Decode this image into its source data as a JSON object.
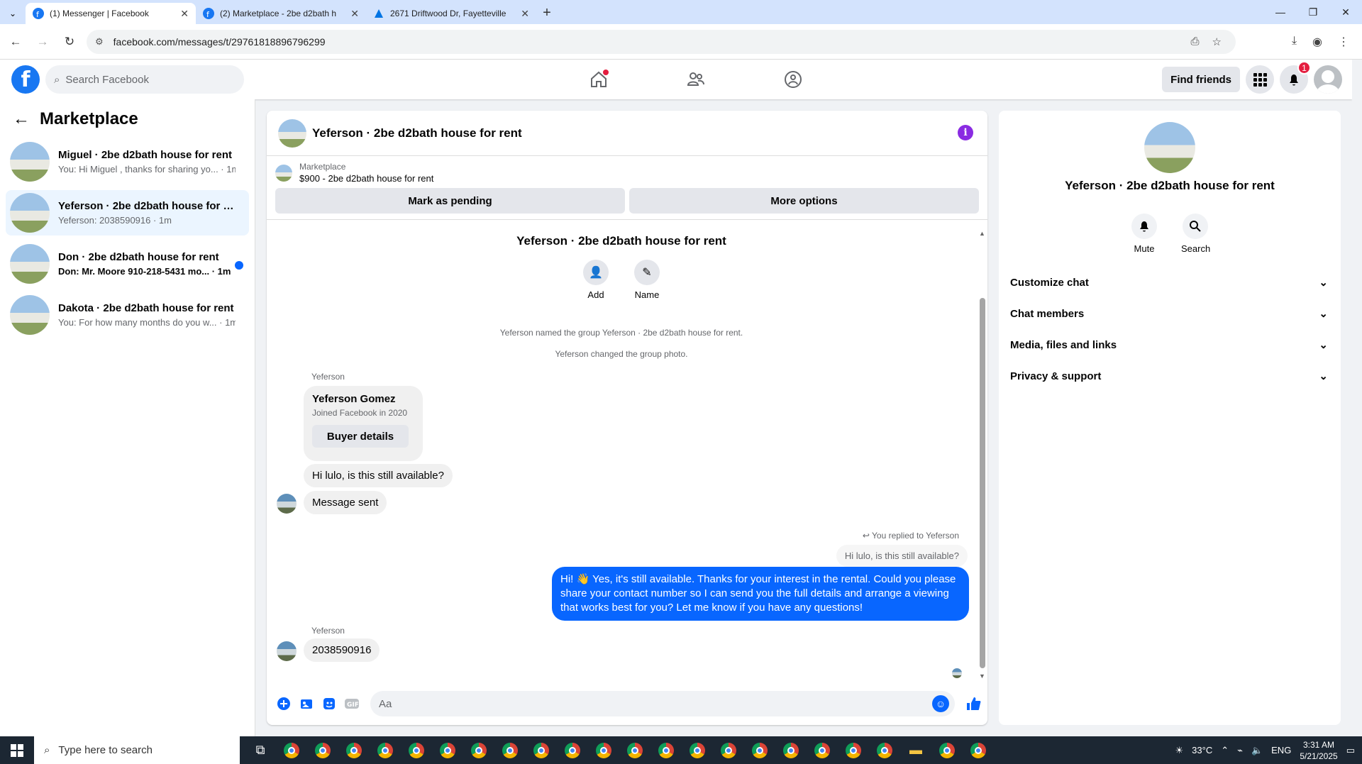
{
  "browser": {
    "tabs": [
      {
        "title": "(1) Messenger | Facebook",
        "active": true
      },
      {
        "title": "(2) Marketplace - 2be d2bath h",
        "active": false
      },
      {
        "title": "2671 Driftwood Dr, Fayetteville",
        "active": false
      }
    ],
    "url": "facebook.com/messages/t/29761818896796299"
  },
  "facebook": {
    "search_placeholder": "Search Facebook",
    "find_friends": "Find friends",
    "notif_count": "1"
  },
  "sidebar": {
    "title": "Marketplace",
    "conversations": [
      {
        "name": "Miguel · 2be d2bath house for rent",
        "preview": "You: Hi Miguel , thanks for sharing yo... · 1m",
        "selected": false,
        "unread": false
      },
      {
        "name": "Yeferson · 2be d2bath house for re...",
        "preview": "Yeferson: 2038590916 · 1m",
        "selected": true,
        "unread": false
      },
      {
        "name": "Don · 2be d2bath house for rent",
        "preview": "Don: Mr. Moore 910-218-5431 mo... · 1m",
        "selected": false,
        "unread": true
      },
      {
        "name": "Dakota · 2be d2bath house for rent",
        "preview": "You: For how many months do you w... · 1m",
        "selected": false,
        "unread": false
      }
    ]
  },
  "chat": {
    "title": "Yeferson · 2be d2bath house for rent",
    "marketplace_label": "Marketplace",
    "listing": "$900 - 2be d2bath house for rent",
    "mark_pending": "Mark as pending",
    "more_options": "More options",
    "thread_title": "Yeferson · 2be d2bath house for rent",
    "add_label": "Add",
    "name_label": "Name",
    "sys1": "Yeferson named the group Yeferson · 2be d2bath house for rent.",
    "sys2": "Yeferson changed the group photo.",
    "sender": "Yeferson",
    "card_name": "Yeferson Gomez",
    "card_sub": "Joined Facebook in 2020",
    "card_btn": "Buyer details",
    "msg1": "Hi lulo, is this still available?",
    "msg2": "Message sent",
    "replied_label": "You replied to Yeferson",
    "quoted": "Hi lulo, is this still available?",
    "my_reply": "Hi! 👋 Yes, it's still available. Thanks for your interest in the rental. Could you please share your contact number so I can send you the full details and arrange a viewing that works best for you? Let me know if you have any questions!",
    "sender2": "Yeferson",
    "msg3": "2038590916",
    "input_placeholder": "Aa"
  },
  "details": {
    "name": "Yeferson · 2be d2bath house for rent",
    "mute": "Mute",
    "search": "Search",
    "sections": [
      "Customize chat",
      "Chat members",
      "Media, files and links",
      "Privacy & support"
    ]
  },
  "taskbar": {
    "search_placeholder": "Type here to search",
    "weather": "33°C",
    "lang": "ENG",
    "time": "3:31 AM",
    "date": "5/21/2025"
  },
  "colors": {
    "accent": "#0866ff",
    "fb_blue": "#1877f2",
    "info_purple": "#8a2be2"
  }
}
